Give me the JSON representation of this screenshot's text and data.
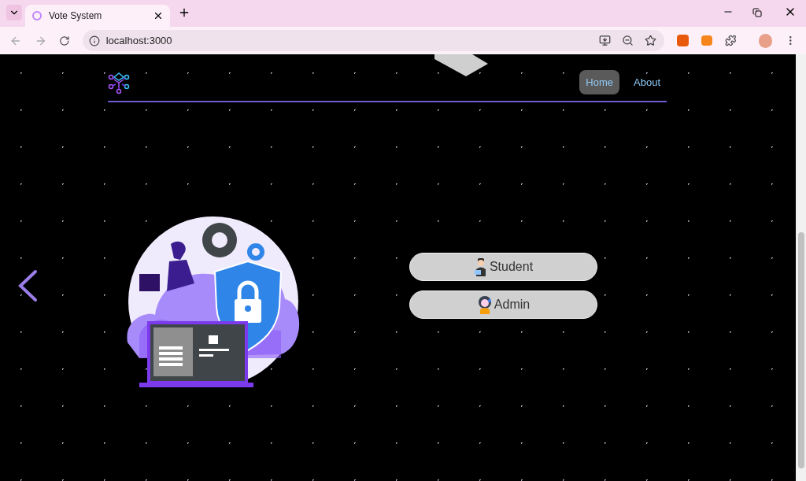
{
  "browser": {
    "tab_title": "Vote System",
    "url": "localhost:3000"
  },
  "nav": {
    "items": [
      {
        "label": "Home",
        "selected": true
      },
      {
        "label": "About",
        "selected": false
      }
    ]
  },
  "roles": [
    {
      "label": "Student",
      "kind": "student"
    },
    {
      "label": "Admin",
      "kind": "admin"
    }
  ]
}
